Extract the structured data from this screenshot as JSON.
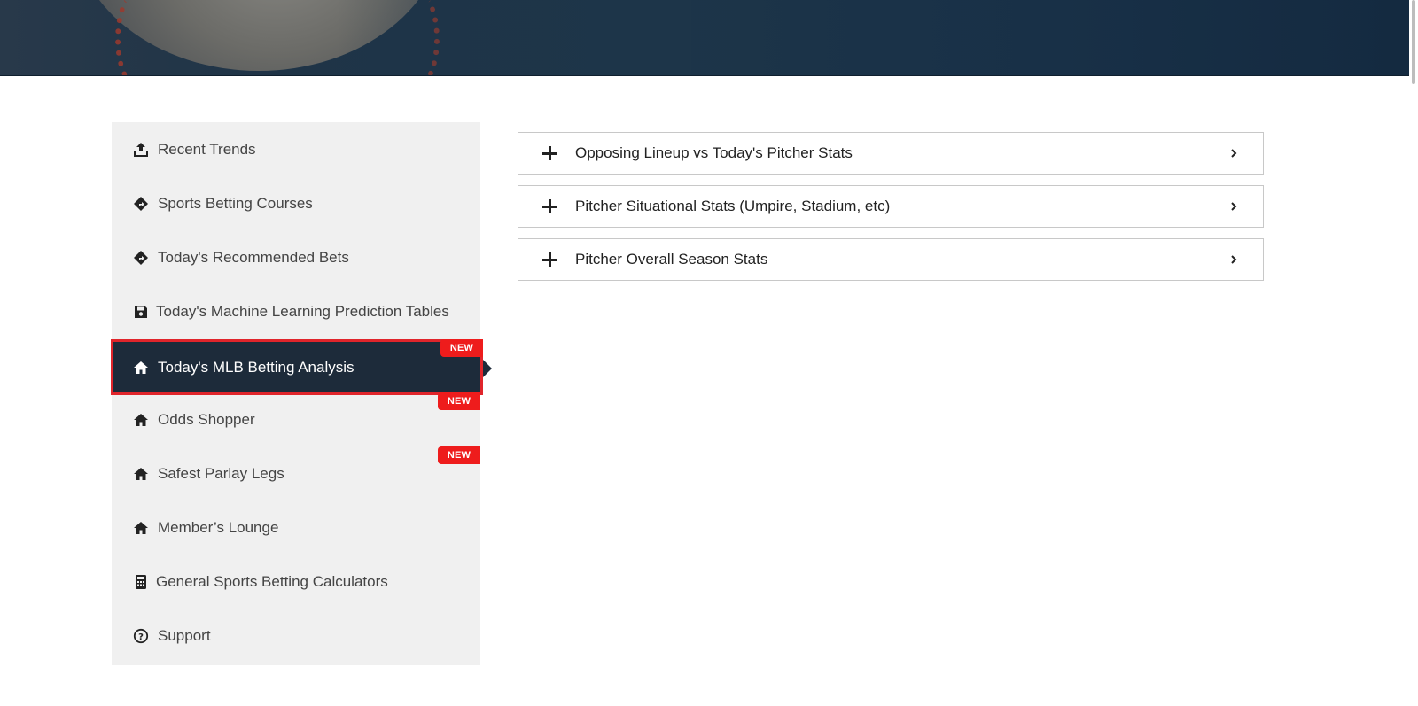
{
  "sidebar": {
    "items": [
      {
        "label": "Recent Trends",
        "icon": "upload-icon"
      },
      {
        "label": "Sports Betting Courses",
        "icon": "direction-sign-icon"
      },
      {
        "label": "Today's Recommended Bets",
        "icon": "direction-sign-icon"
      },
      {
        "label": "Today's Machine Learning Prediction Tables",
        "icon": "save-icon"
      },
      {
        "label": "Today's MLB Betting Analysis",
        "icon": "home-icon",
        "active": true,
        "badge": "NEW"
      },
      {
        "label": "Odds Shopper",
        "icon": "home-icon",
        "badge": "NEW"
      },
      {
        "label": "Safest Parlay Legs",
        "icon": "home-icon",
        "badge": "NEW"
      },
      {
        "label": "Member’s Lounge",
        "icon": "home-icon"
      },
      {
        "label": "General Sports Betting Calculators",
        "icon": "calculator-icon"
      },
      {
        "label": "Support",
        "icon": "question-circle-icon"
      }
    ]
  },
  "accordions": [
    {
      "label": "Opposing Lineup vs Today's Pitcher Stats"
    },
    {
      "label": "Pitcher Situational Stats (Umpire, Stadium, etc)"
    },
    {
      "label": "Pitcher Overall Season Stats"
    }
  ],
  "colors": {
    "active_bg": "#1d2b3a",
    "active_border": "#e0252b",
    "badge": "#ee1c1c",
    "sidebar_bg": "#f0f0f0"
  }
}
